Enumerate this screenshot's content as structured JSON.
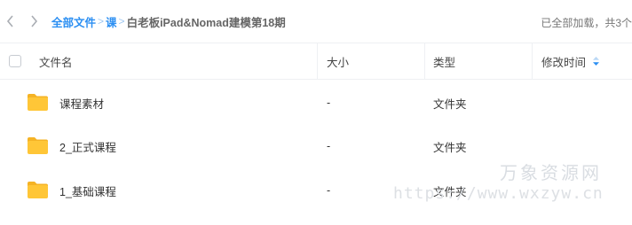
{
  "nav": {
    "breadcrumb": [
      {
        "label": "全部文件"
      },
      {
        "label": "课"
      },
      {
        "label": "白老板iPad&Nomad建模第18期"
      }
    ],
    "separator": ">",
    "load_status": "已全部加载，共3个"
  },
  "columns": {
    "name": "文件名",
    "size": "大小",
    "type": "类型",
    "modified": "修改时间"
  },
  "files": [
    {
      "name": "课程素材",
      "size": "-",
      "type": "文件夹",
      "icon": "folder-icon"
    },
    {
      "name": "2_正式课程",
      "size": "-",
      "type": "文件夹",
      "icon": "folder-icon"
    },
    {
      "name": "1_基础课程",
      "size": "-",
      "type": "文件夹",
      "icon": "folder-icon"
    }
  ],
  "watermark": {
    "brand": "万象资源网",
    "url": "https://www.wxzyw.cn"
  },
  "colors": {
    "accent": "#2c8ff2",
    "folder": "#ffc637",
    "divider": "#eef0f3"
  }
}
